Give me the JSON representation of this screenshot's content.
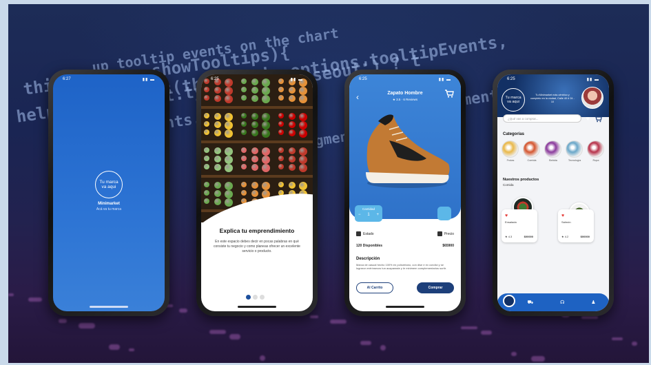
{
  "code_lines": [
    "up tooltip events on the chart",
    "this.options.showTooltips){",
    "Events(this, this.options.tooltipEvents,",
    "helpers.each(evt.type !== 'mouseout') ? t",
    "function(segment){",
    "}, this);",
    "ments.",
    "segments.",
    "rs.",
    "vent"
  ],
  "status_time": "6:27",
  "phone1": {
    "logo": "Tu marca va aqui",
    "brand": "Minimarket",
    "tagline": "Acá va tu marca"
  },
  "phone2": {
    "time": "6:25",
    "title": "Explica tu emprendimiento",
    "description": "En este espacio debes decir en pocas palabras en qué consiste tu negocio y como planeas ofrecer un excelente servicio o producto."
  },
  "phone3": {
    "time": "6:25",
    "product_title": "Zapato Hombre",
    "rating": "★ 3.5 · 6 Reviews",
    "qty_label": "Cantidad",
    "qty_minus": "−",
    "qty_value": "1",
    "qty_plus": "+",
    "label_left": "Estado",
    "label_right": "Precio",
    "available": "120 Disponibles",
    "price": "$65900",
    "section": "Descripción",
    "description": "Marca de casual hecho 100% en poliuretano, con dise e ex condici y se lograron extrínsecos tun acaparaste y le minimem complementarios surtir.",
    "btn_cart": "Al Carrito",
    "btn_buy": "Comprar"
  },
  "phone4": {
    "time": "6:25",
    "logo": "Tu marca va aqui",
    "header_text": "Tu Minimarket más céntrico y completo en la ciudad, Calle 40 # 24 - 10",
    "search_placeholder": "¿Qué vas a comprar...",
    "categories_title": "Categorías",
    "categories": [
      {
        "name": "Frutas",
        "color": "#e9b84a"
      },
      {
        "name": "Comida",
        "color": "#d4552f"
      },
      {
        "name": "Bebida",
        "color": "#8a3a9c"
      },
      {
        "name": "Tecnología",
        "color": "#6aa7c9"
      },
      {
        "name": "Ropa",
        "color": "#b7324a"
      }
    ],
    "products_title": "Nuestros productos",
    "products_sub": "Comida",
    "products": [
      {
        "name": "Ensalada",
        "rating": "★ 4.3",
        "price": "$00000"
      },
      {
        "name": "Salmón",
        "rating": "★ 4.2",
        "price": "$00000"
      }
    ]
  }
}
